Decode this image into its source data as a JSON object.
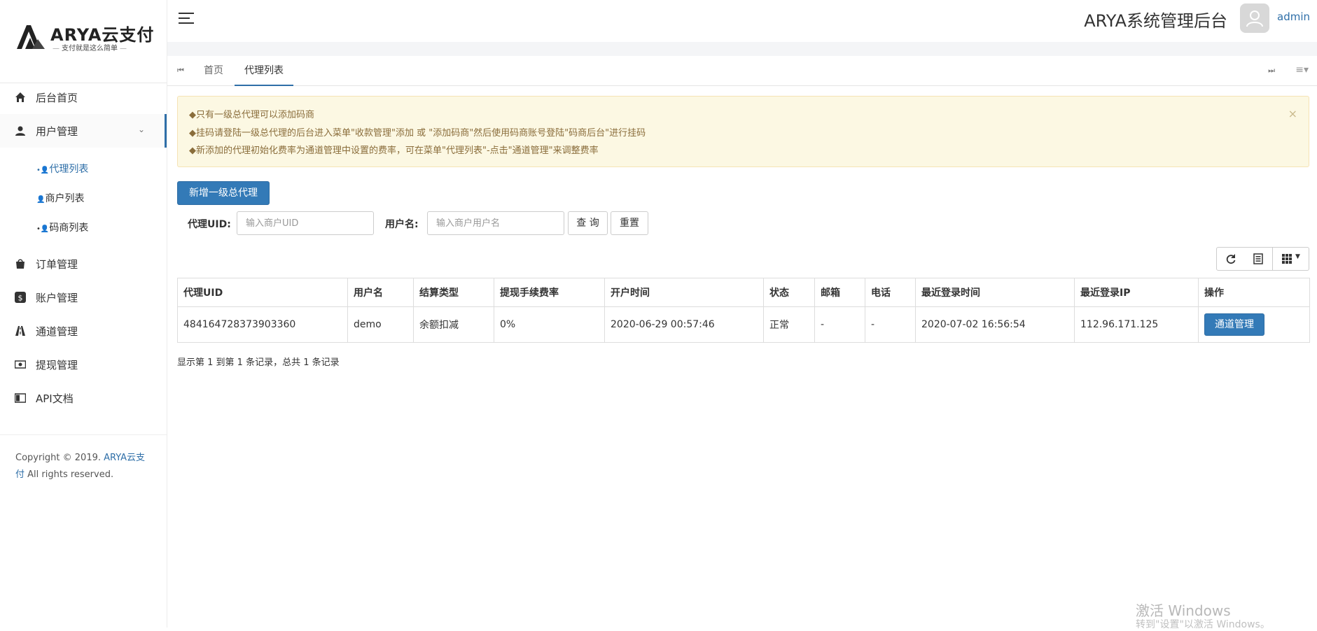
{
  "brand": {
    "name": "ARYA云支付",
    "slogan": "支付就是这么简单"
  },
  "sidebar": {
    "items": [
      {
        "label": "后台首页",
        "icon": "home-icon"
      },
      {
        "label": "用户管理",
        "icon": "user-icon",
        "expanded": true
      },
      {
        "label": "订单管理",
        "icon": "shopping-bag-icon"
      },
      {
        "label": "账户管理",
        "icon": "dollar-icon"
      },
      {
        "label": "通道管理",
        "icon": "road-icon"
      },
      {
        "label": "提现管理",
        "icon": "money-icon"
      },
      {
        "label": "API文档",
        "icon": "book-icon"
      }
    ],
    "sub_items": [
      {
        "label": "代理列表",
        "icon": "users-icon",
        "current": true
      },
      {
        "label": "商户列表",
        "icon": "user-icon"
      },
      {
        "label": "码商列表",
        "icon": "users-icon"
      }
    ],
    "copyright_prefix": "Copyright © 2019. ",
    "copyright_link": "ARYA云支付",
    "copyright_suffix": " All rights reserved."
  },
  "header": {
    "title": "ARYA系统管理后台",
    "username": "admin"
  },
  "tabs": [
    {
      "label": "首页",
      "active": false
    },
    {
      "label": "代理列表",
      "active": true
    }
  ],
  "alert": {
    "lines": [
      "只有一级总代理可以添加码商",
      "挂码请登陆一级总代理的后台进入菜单\"收款管理\"添加 或 \"添加码商\"然后使用码商账号登陆\"码商后台\"进行挂码",
      "新添加的代理初始化费率为通道管理中设置的费率，可在菜单\"代理列表\"-点击\"通道管理\"来调整费率"
    ],
    "close": "×"
  },
  "actions": {
    "add_label": "新增一级总代理"
  },
  "search": {
    "uid_label": "代理UID:",
    "uid_placeholder": "输入商户UID",
    "username_label": "用户名:",
    "username_placeholder": "输入商户用户名",
    "query_label": "查 询",
    "reset_label": "重置"
  },
  "table": {
    "columns": [
      "代理UID",
      "用户名",
      "结算类型",
      "提现手续费率",
      "开户时间",
      "状态",
      "邮箱",
      "电话",
      "最近登录时间",
      "最近登录IP",
      "操作"
    ],
    "rows": [
      {
        "uid": "484164728373903360",
        "username": "demo",
        "settle_type": "余额扣减",
        "fee_rate": "0%",
        "created": "2020-06-29 00:57:46",
        "status": "正常",
        "email": "-",
        "phone": "-",
        "last_login": "2020-07-02 16:56:54",
        "last_ip": "112.96.171.125",
        "action": "通道管理"
      }
    ]
  },
  "pager": {
    "info": "显示第 1 到第 1 条记录，总共 1 条记录"
  },
  "watermark": {
    "line1": "激活 Windows",
    "line2": "转到\"设置\"以激活 Windows。"
  },
  "colors": {
    "primary": "#337ab7",
    "alert_bg": "#fcf8e3",
    "alert_text": "#8a6d3b"
  }
}
